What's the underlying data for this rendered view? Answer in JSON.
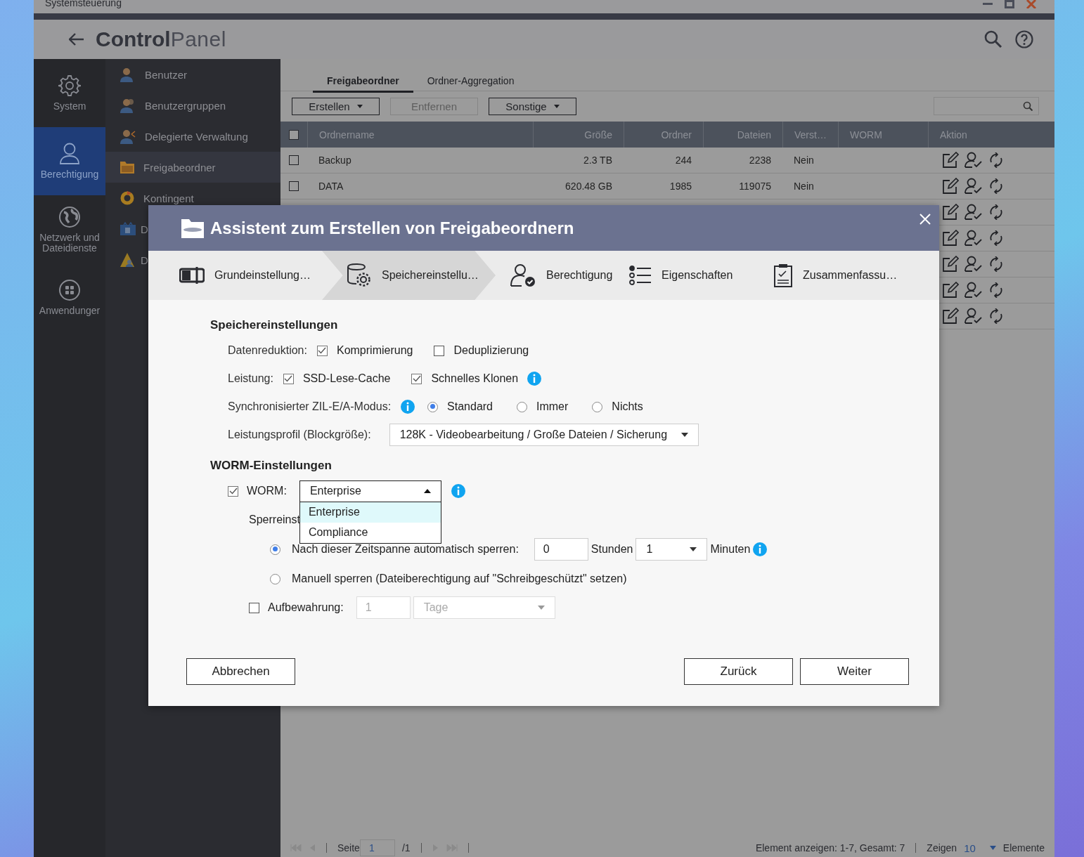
{
  "window": {
    "title": "Systemsteuerung"
  },
  "header": {
    "title_bold": "Control",
    "title_light": "Panel"
  },
  "categories": [
    {
      "label": "System",
      "selected": false
    },
    {
      "label": "Berechtigung",
      "selected": true
    },
    {
      "label": "Netzwerk und Dateidienste",
      "selected": false
    },
    {
      "label": "Anwendunger",
      "selected": false
    }
  ],
  "menu": [
    {
      "label": "Benutzer",
      "selected": false
    },
    {
      "label": "Benutzergruppen",
      "selected": false
    },
    {
      "label": "Delegierte Verwaltung",
      "selected": false
    },
    {
      "label": "Freigabeordner",
      "selected": true
    },
    {
      "label": "Kontingent",
      "selected": false
    },
    {
      "label": "D",
      "selected": false
    },
    {
      "label": "D",
      "selected": false
    }
  ],
  "tabs": [
    {
      "label": "Freigabeordner",
      "selected": true
    },
    {
      "label": "Ordner-Aggregation",
      "selected": false
    }
  ],
  "toolbar": [
    {
      "label": "Erstellen",
      "dropdown": true,
      "disabled": false
    },
    {
      "label": "Entfernen",
      "dropdown": false,
      "disabled": true
    },
    {
      "label": "Sonstige",
      "dropdown": true,
      "disabled": false
    }
  ],
  "table": {
    "all_checked": false,
    "columns": [
      "Ordnername",
      "Größe",
      "Ordner",
      "Dateien",
      "Verst…",
      "WORM",
      "Aktion"
    ],
    "rows": [
      {
        "checked": false,
        "name": "Backup",
        "size": "2.3 TB",
        "folders": "244",
        "files": "2238",
        "version": "Nein"
      },
      {
        "checked": false,
        "name": "DATA",
        "size": "620.48 GB",
        "folders": "1985",
        "files": "119075",
        "version": "Nein"
      },
      {},
      {},
      {},
      {},
      {}
    ]
  },
  "pager": {
    "page_label": "Seite",
    "page": "1",
    "total": "/1",
    "summary": "Element anzeigen: 1-7, Gesamt: 7",
    "show_label": "Zeigen",
    "per_page": "10",
    "unit": "Elemente"
  },
  "dialog": {
    "title": "Assistent zum Erstellen von Freigabeordnern",
    "steps": [
      {
        "label": "Grundeinstellung…",
        "selected": false
      },
      {
        "label": "Speichereinstellu…",
        "selected": true
      },
      {
        "label": "Berechtigung",
        "selected": false
      },
      {
        "label": "Eigenschaften",
        "selected": false
      },
      {
        "label": "Zusammenfassu…",
        "selected": false
      }
    ],
    "storage": {
      "heading": "Speichereinstellungen",
      "data_reduction": {
        "label": "Datenreduktion:",
        "options": [
          {
            "label": "Komprimierung",
            "checked": true
          },
          {
            "label": "Deduplizierung",
            "checked": false
          }
        ]
      },
      "performance": {
        "label": "Leistung:",
        "options": [
          {
            "label": "SSD-Lese-Cache",
            "checked": true
          },
          {
            "label": "Schnelles Klonen",
            "checked": true
          }
        ]
      },
      "sync_mode": {
        "label": "Synchronisierter ZIL-E/A-Modus:",
        "options": [
          {
            "label": "Standard",
            "selected": true
          },
          {
            "label": "Immer",
            "selected": false
          },
          {
            "label": "Nichts",
            "selected": false
          }
        ]
      },
      "profile": {
        "label": "Leistungsprofil (Blockgröße):",
        "value": "128K - Videobearbeitung / Große Dateien / Sicherung"
      }
    },
    "worm": {
      "heading": "WORM-Einstellungen",
      "label": "WORM:",
      "checked": true,
      "value": "Enterprise",
      "expanded": true,
      "options": [
        {
          "label": "Enterprise",
          "selected": true
        },
        {
          "label": "Compliance",
          "selected": false
        }
      ],
      "lock_label": "Sperreinst",
      "lock_options": [
        {
          "label": "Nach dieser Zeitspanne automatisch sperren:",
          "selected": true
        },
        {
          "label": "Manuell sperren (Dateiberechtigung auf \"Schreibgeschützt\" setzen)",
          "selected": false
        }
      ],
      "hours": "0",
      "hours_label": "Stunden",
      "minutes": "1",
      "minutes_label": "Minuten",
      "retention": {
        "label": "Aufbewahrung:",
        "checked": false,
        "value": "1",
        "unit": "Tage",
        "disabled": true
      }
    },
    "buttons": {
      "cancel": "Abbrechen",
      "back": "Zurück",
      "next": "Weiter"
    }
  }
}
